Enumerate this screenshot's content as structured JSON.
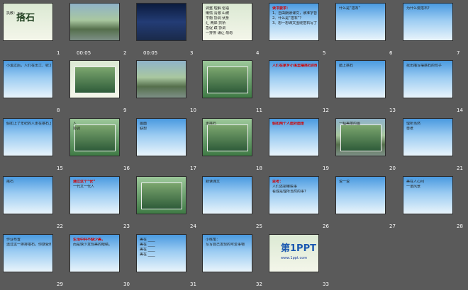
{
  "slides": [
    {
      "n": "1",
      "lines": [
        "搭石",
        "执教：××"
      ],
      "dur": ""
    },
    {
      "n": "2",
      "lines": [],
      "dur": "00:05"
    },
    {
      "n": "3",
      "lines": [],
      "dur": "00:05"
    },
    {
      "n": "4",
      "lines": [
        "调整 理解 俗语",
        "懒惰 清澈 山坡",
        "平衡 协调 伏身",
        "汇 两岸 拱桥",
        "急促 蹼 协调",
        "一排排 谦让 匆匆"
      ],
      "dur": ""
    },
    {
      "n": "5",
      "lines": [
        "读书要求：",
        "1、自由朗读课文，读准字音，读通句子。",
        "2、什么是“搭石”？",
        "3、想一想课文围绕搭石写了哪些事？"
      ],
      "dur": ""
    },
    {
      "n": "6",
      "lines": [
        "什么是“搭石”"
      ],
      "dur": ""
    },
    {
      "n": "7",
      "lines": [
        "为什么要搭石?"
      ],
      "dur": ""
    },
    {
      "n": "8",
      "lines": [
        "小溪过后，人们在出工、收工、赶集、探亲、串门路过的小溪。"
      ],
      "dur": ""
    },
    {
      "n": "9",
      "lines": [],
      "dur": ""
    },
    {
      "n": "10",
      "lines": [],
      "dur": ""
    },
    {
      "n": "11",
      "lines": [],
      "dur": ""
    },
    {
      "n": "12",
      "lines": [
        "人们在家乡小溪里摆搭石的情景"
      ],
      "dur": ""
    },
    {
      "n": "13",
      "lines": [
        "踏上搭石"
      ],
      "dur": ""
    },
    {
      "n": "14",
      "lines": [
        "找出描写摆搭石的句子"
      ],
      "dur": ""
    },
    {
      "n": "15",
      "lines": [
        "假如上了年纪的人走在搭石上"
      ],
      "dur": ""
    },
    {
      "n": "16",
      "lines": [
        "人",
        "协调"
      ],
      "dur": ""
    },
    {
      "n": "17",
      "lines": [
        "画面",
        "联想"
      ],
      "dur": ""
    },
    {
      "n": "18",
      "lines": [
        "走搭石"
      ],
      "dur": ""
    },
    {
      "n": "19",
      "lines": [
        "假如两个人面对面走"
      ],
      "dur": ""
    },
    {
      "n": "20",
      "lines": [
        "一幅美丽的画"
      ],
      "dur": ""
    },
    {
      "n": "21",
      "lines": [
        "理所当然",
        "尊老"
      ],
      "dur": ""
    },
    {
      "n": "22",
      "lines": [
        "搭石"
      ],
      "dur": ""
    },
    {
      "n": "23",
      "lines": [
        "通过这个“伏”",
        "一代又一代人"
      ],
      "dur": ""
    },
    {
      "n": "24",
      "lines": [],
      "dur": ""
    },
    {
      "n": "25",
      "lines": [
        "默读课文"
      ],
      "dur": ""
    },
    {
      "n": "26",
      "lines": [
        "思考：",
        "人们还把哪些事",
        "看成是理所当然的事?"
      ],
      "dur": ""
    },
    {
      "n": "27",
      "lines": [
        "说一说"
      ],
      "dur": ""
    },
    {
      "n": "28",
      "lines": [
        "美在人心间",
        "一道风景"
      ],
      "dur": ""
    },
    {
      "n": "29",
      "lines": [
        "作业布置",
        "透过这一排排搭石，你感受到了什么?"
      ],
      "dur": ""
    },
    {
      "n": "30",
      "lines": [
        "生活中并不缺少美，",
        "而是缺少发现美的眼睛。"
      ],
      "dur": ""
    },
    {
      "n": "31",
      "lines": [
        "美在 ____",
        "美在 ____",
        "美在 ____",
        "美在 ____"
      ],
      "dur": ""
    },
    {
      "n": "32",
      "lines": [
        "小练笔：",
        "写写自己发现的可爱事物"
      ],
      "dur": ""
    },
    {
      "n": "33",
      "lines": [
        "第1PPT",
        "www.1ppt.com"
      ],
      "dur": ""
    }
  ]
}
